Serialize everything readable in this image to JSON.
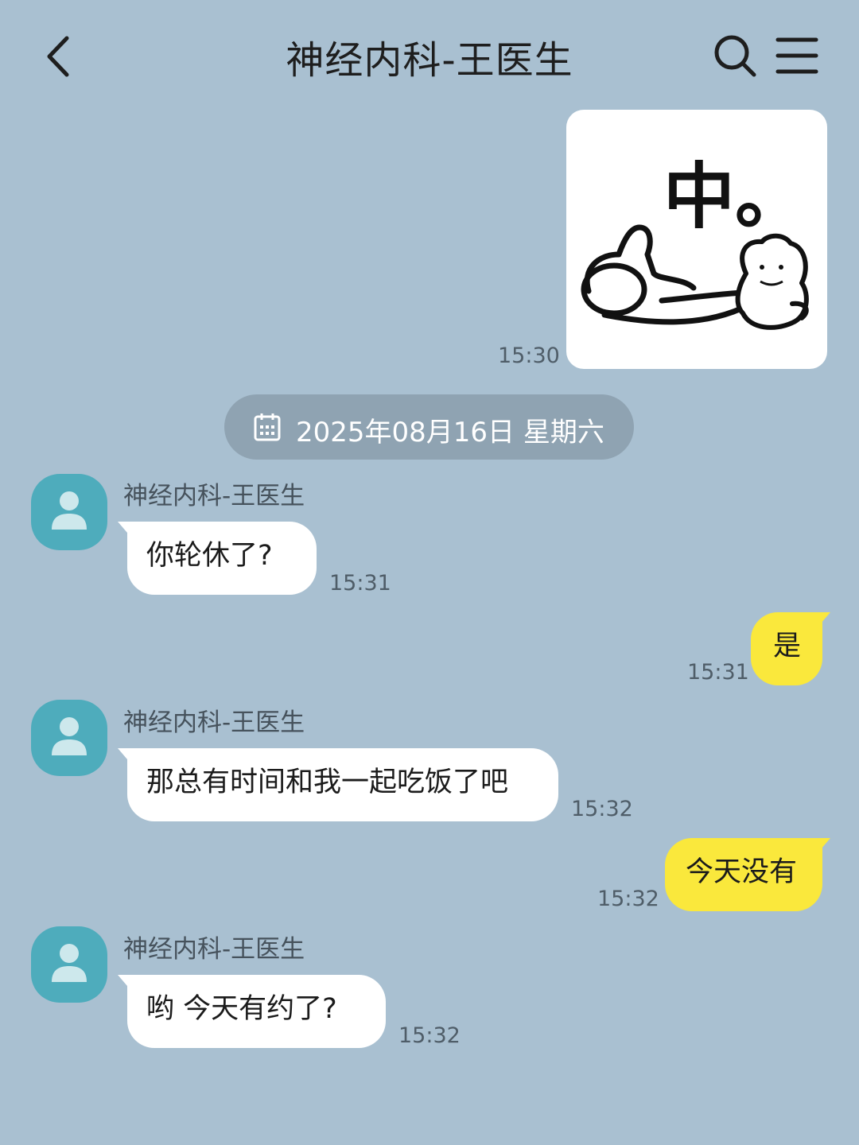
{
  "header": {
    "title": "神经内科-王医生",
    "back_icon": "chevron-left-icon",
    "search_icon": "search-icon",
    "menu_icon": "menu-icon"
  },
  "date_separator": {
    "icon": "calendar-icon",
    "text": "2025年08月16日 星期六"
  },
  "messages": [
    {
      "direction": "out",
      "type": "sticker",
      "sticker_text": "中。",
      "time": "15:30"
    },
    {
      "direction": "in",
      "sender": "神经内科-王医生",
      "text": "你轮休了?",
      "time": "15:31"
    },
    {
      "direction": "out",
      "text": "是",
      "time": "15:31"
    },
    {
      "direction": "in",
      "sender": "神经内科-王医生",
      "text": "那总有时间和我一起吃饭了吧",
      "time": "15:32"
    },
    {
      "direction": "out",
      "text": "今天没有",
      "time": "15:32"
    },
    {
      "direction": "in",
      "sender": "神经内科-王医生",
      "text": "哟 今天有约了?",
      "time": "15:32"
    }
  ],
  "colors": {
    "background": "#a9c0d1",
    "incoming_bubble": "#ffffff",
    "outgoing_bubble": "#fae83c",
    "avatar": "#4eacbc",
    "date_pill": "#8fa3b2"
  }
}
